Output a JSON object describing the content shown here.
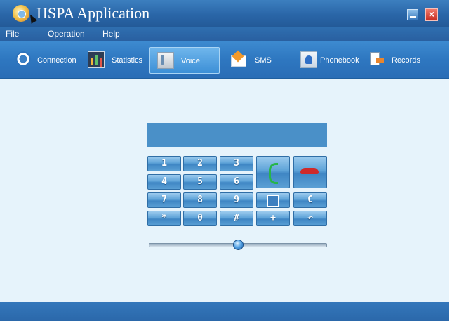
{
  "window": {
    "title": "HSPA Application"
  },
  "menu": {
    "items": [
      "File",
      "Operation",
      "Help"
    ]
  },
  "toolbar": {
    "tabs": [
      {
        "label": "Connection",
        "icon": "connection-icon"
      },
      {
        "label": "Statistics",
        "icon": "statistics-icon"
      },
      {
        "label": "Voice",
        "icon": "voice-icon",
        "active": true
      },
      {
        "label": "SMS",
        "icon": "sms-icon"
      },
      {
        "label": "Phonebook",
        "icon": "phonebook-icon"
      },
      {
        "label": "Records",
        "icon": "records-icon"
      }
    ]
  },
  "dialer": {
    "display": "",
    "keys": [
      "1",
      "2",
      "3",
      "4",
      "5",
      "6",
      "7",
      "8",
      "9",
      "*",
      "0",
      "#",
      "+"
    ],
    "clear_label": "C",
    "call_icon": "phone-call-icon",
    "hangup_icon": "phone-hangup-icon",
    "contacts_icon": "contacts-icon",
    "back_icon": "redial-arrow-icon",
    "volume_level": 0.5
  },
  "colors": {
    "accent": "#2e77c0",
    "background": "#e6f3fb",
    "call": "#27b54a",
    "hangup": "#cf2a2a"
  }
}
